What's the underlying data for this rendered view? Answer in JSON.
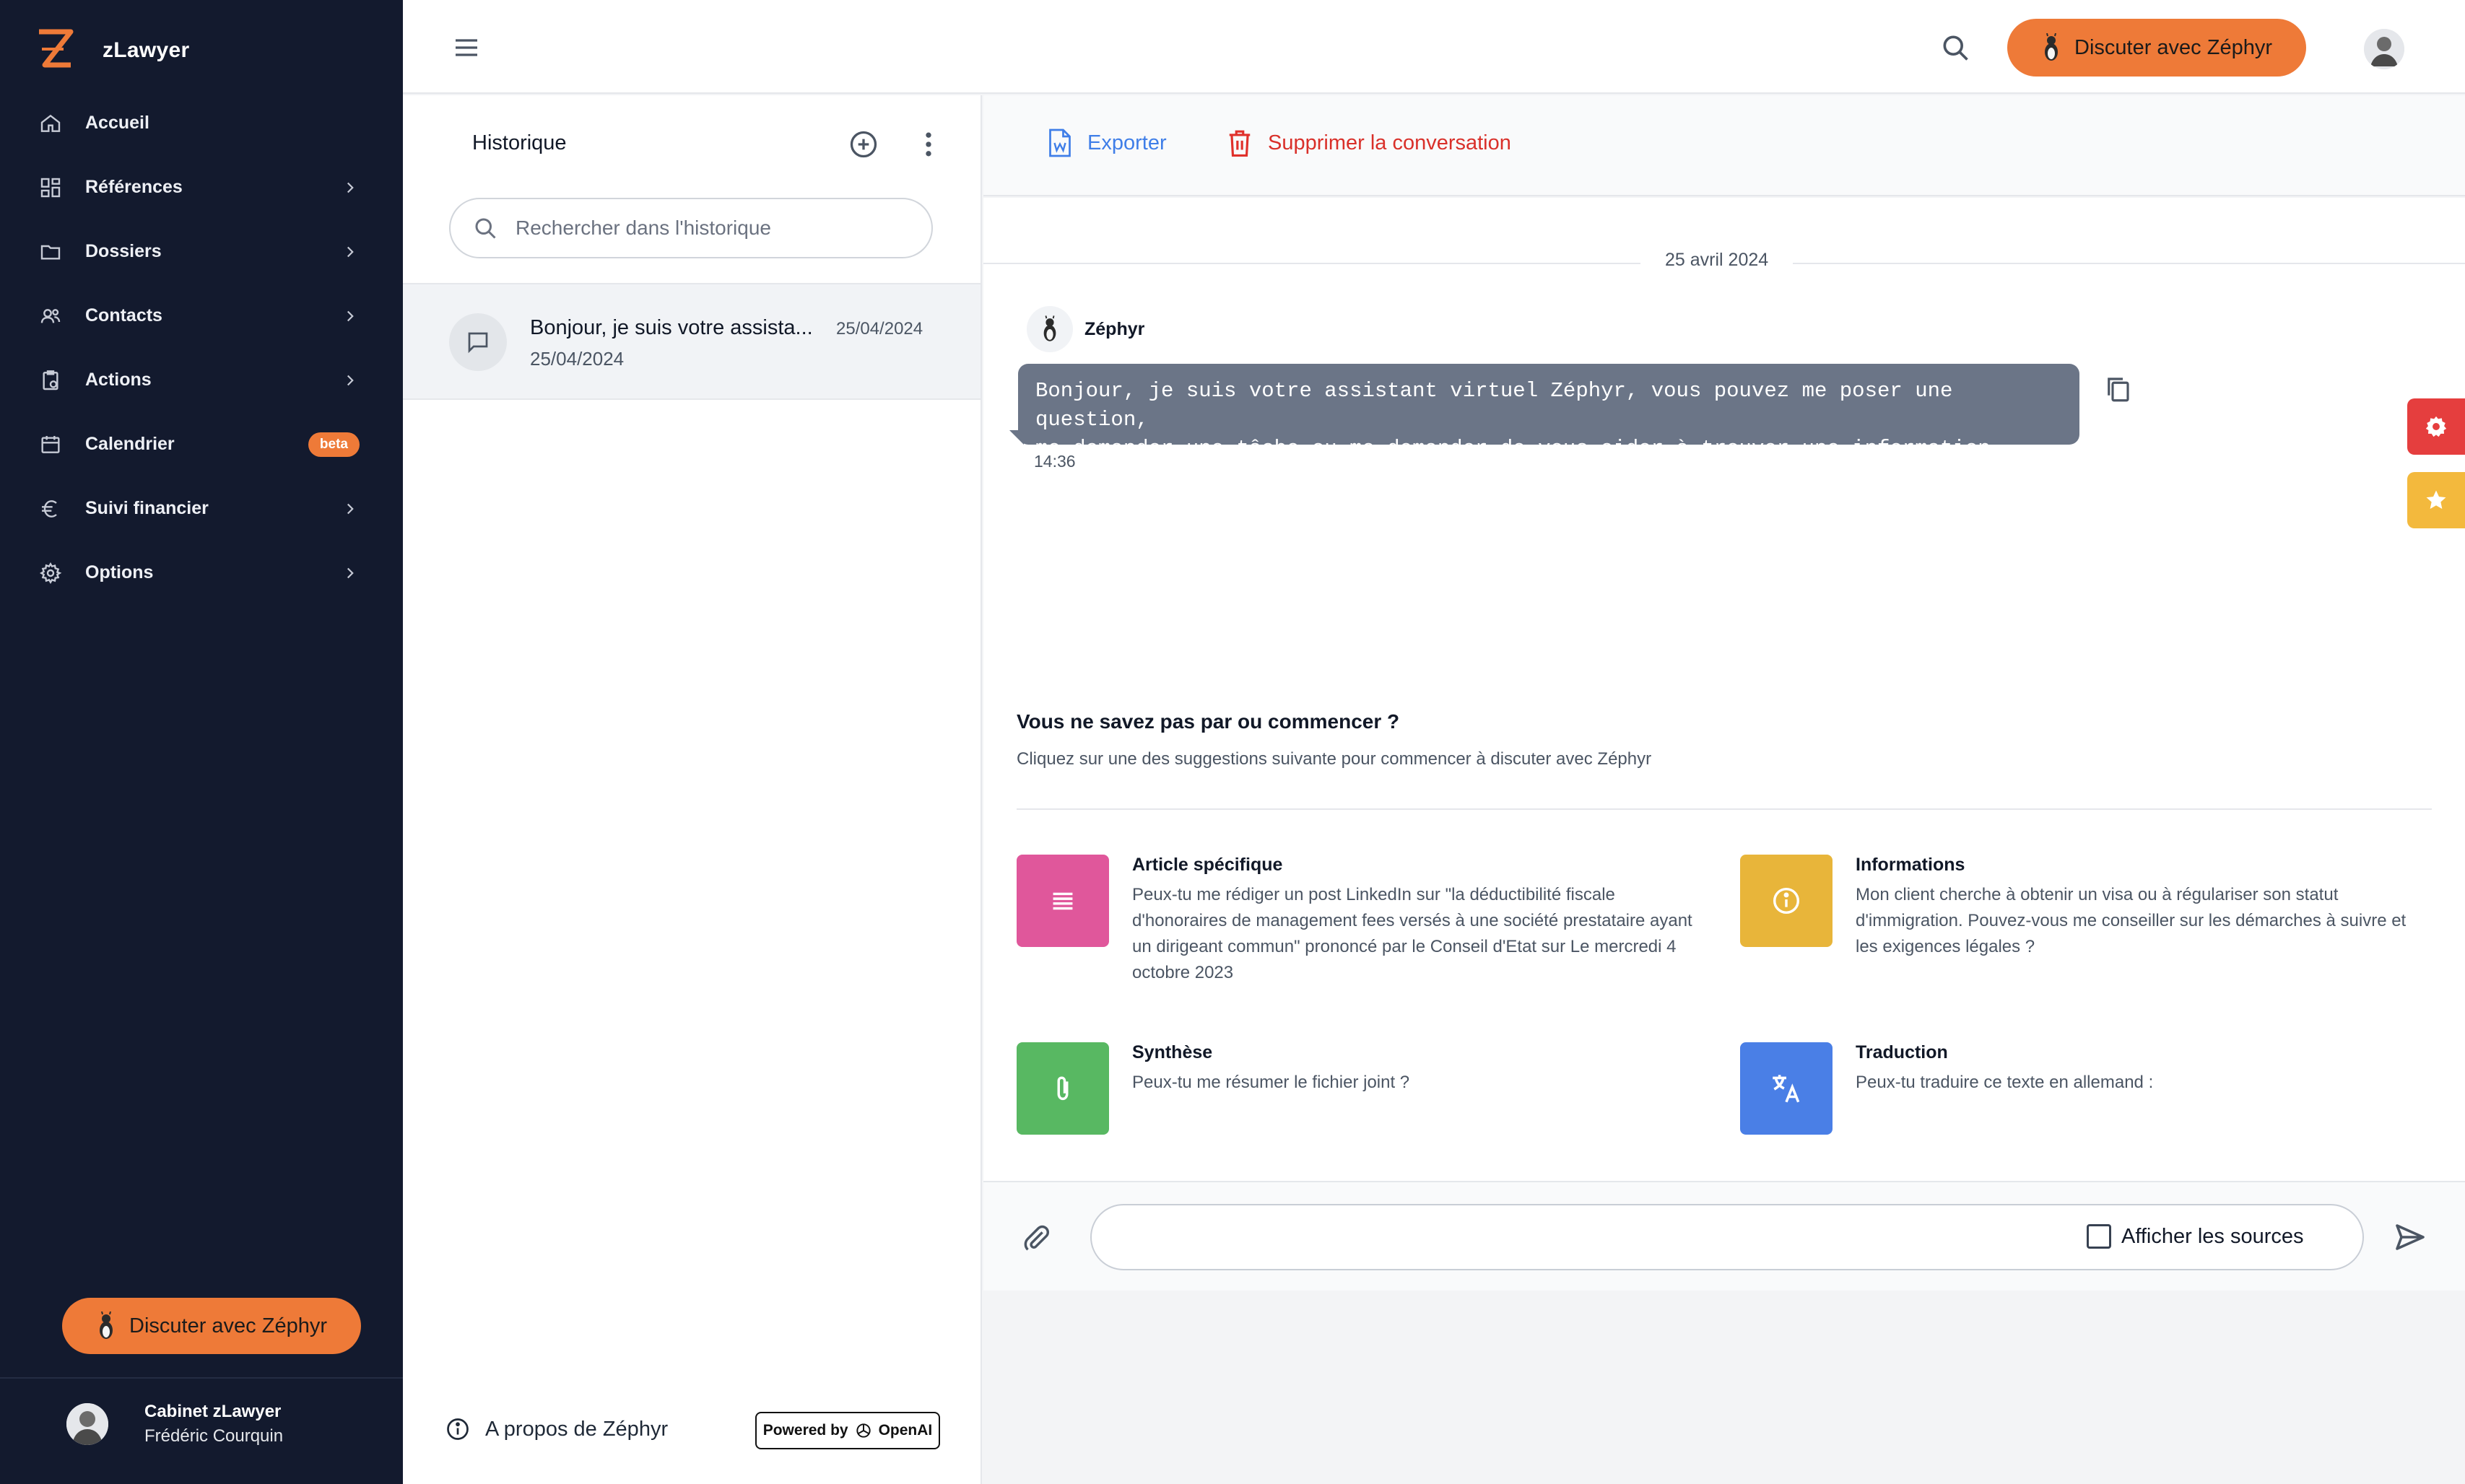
{
  "app": {
    "name": "zLawyer"
  },
  "colors": {
    "sidebar_bg": "#131a2e",
    "accent": "#ee7a38",
    "link_blue": "#3f7ee8",
    "danger": "#d9302a"
  },
  "sidebar": {
    "items": [
      {
        "label": "Accueil",
        "icon": "home-icon"
      },
      {
        "label": "Références",
        "icon": "grid-icon"
      },
      {
        "label": "Dossiers",
        "icon": "folder-icon"
      },
      {
        "label": "Contacts",
        "icon": "users-icon"
      },
      {
        "label": "Actions",
        "icon": "clipboard-icon"
      },
      {
        "label": "Calendrier",
        "icon": "calendar-icon",
        "badge": "beta"
      },
      {
        "label": "Suivi financier",
        "icon": "euro-icon"
      },
      {
        "label": "Options",
        "icon": "gear-icon"
      }
    ],
    "cta_label": "Discuter avec Zéphyr",
    "user": {
      "org": "Cabinet zLawyer",
      "name": "Frédéric Courquin"
    }
  },
  "topbar": {
    "cta_label": "Discuter avec Zéphyr"
  },
  "history": {
    "title": "Historique",
    "search_placeholder": "Rechercher dans l'historique",
    "conversations": [
      {
        "title": "Bonjour, je suis votre assista...",
        "date": "25/04/2024",
        "subtitle": "25/04/2024"
      }
    ],
    "about_label": "A propos de Zéphyr",
    "powered_by": "Powered by",
    "powered_brand": "OpenAI"
  },
  "main": {
    "export_label": "Exporter",
    "delete_label": "Supprimer la conversation",
    "date_separator": "25 avril 2024",
    "message": {
      "author": "Zéphyr",
      "line1": "Bonjour, je suis votre assistant virtuel Zéphyr, vous pouvez me poser une question,",
      "line2": "me demander une tâche ou me demander de vous aider à trouver une information.",
      "time": "14:36"
    },
    "suggestions": {
      "title": "Vous ne savez pas par ou commencer ?",
      "subtitle": "Cliquez sur une des suggestions suivante pour commencer à discuter avec Zéphyr",
      "cards": [
        {
          "title": "Article spécifique",
          "desc": "Peux-tu me rédiger un post LinkedIn sur \"la déductibilité fiscale d'honoraires de management fees versés à une société prestataire ayant un dirigeant commun\" prononcé par le Conseil d'Etat sur Le mercredi 4 octobre 2023",
          "color": "#e0579b",
          "icon": "lines-icon"
        },
        {
          "title": "Informations",
          "desc": "Mon client cherche à obtenir un visa ou à régulariser son statut d'immigration. Pouvez-vous me conseiller sur les démarches à suivre et les exigences légales ?",
          "color": "#e8b53a",
          "icon": "info-icon"
        },
        {
          "title": "Synthèse",
          "desc": "Peux-tu me résumer le fichier joint ?",
          "color": "#58b862",
          "icon": "paperclip-icon"
        },
        {
          "title": "Traduction",
          "desc": "Peux-tu traduire ce texte en allemand :",
          "color": "#4a7fe6",
          "icon": "translate-icon"
        }
      ]
    },
    "composer": {
      "placeholder": "",
      "sources_label": "Afficher les sources"
    }
  }
}
